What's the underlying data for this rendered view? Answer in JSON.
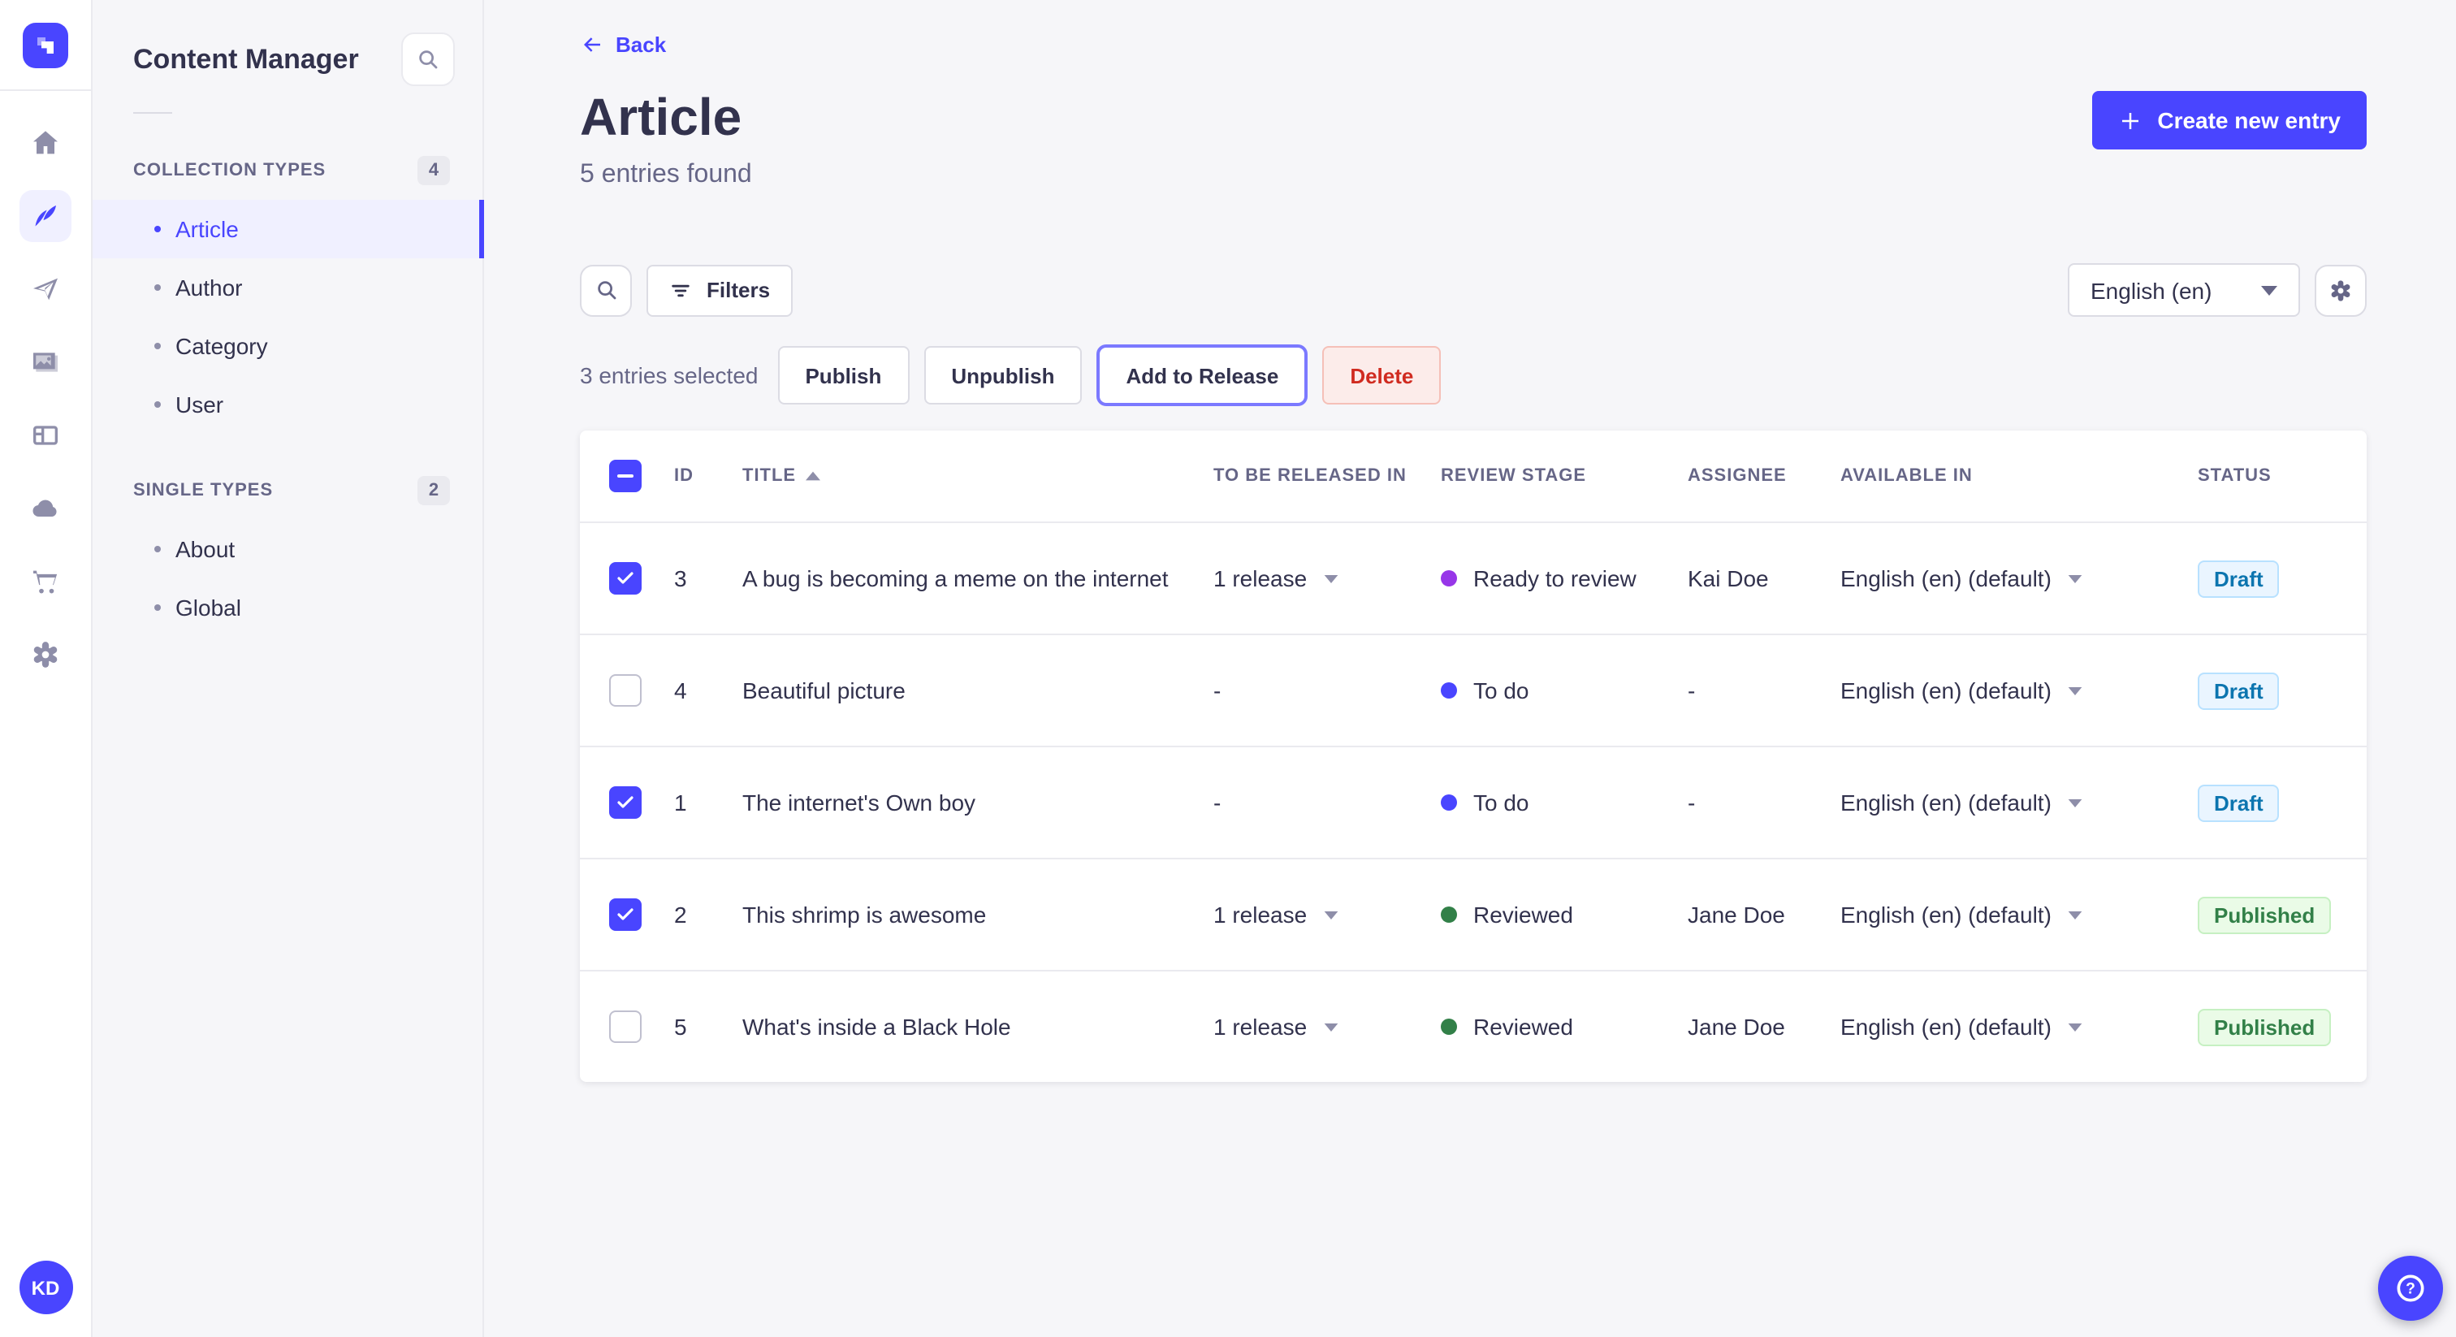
{
  "colors": {
    "primary": "#4945FF",
    "primary_light": "#F0F0FF",
    "text": "#32324D",
    "muted": "#666687",
    "border": "#EAEAEF",
    "status_draft_bg": "#EAF5FF",
    "status_draft_text": "#0C75AF",
    "status_published_bg": "#EAFBE7",
    "status_published_text": "#328048",
    "delete_bg": "#FCECEA",
    "delete_text": "#D02B20",
    "release_focus_border": "#7B79FF"
  },
  "rail": {
    "icons": [
      "strapi-logo",
      "home",
      "content-manager",
      "releases-paper-plane",
      "media-library",
      "content-type-builder",
      "cloud",
      "marketplace-cart",
      "settings-gear"
    ],
    "active_icon": "content-manager",
    "avatar_initials": "KD"
  },
  "subnav": {
    "title": "Content Manager",
    "sections": [
      {
        "label": "COLLECTION TYPES",
        "badge": "4",
        "items": [
          {
            "label": "Article",
            "active": true
          },
          {
            "label": "Author",
            "active": false
          },
          {
            "label": "Category",
            "active": false
          },
          {
            "label": "User",
            "active": false
          }
        ]
      },
      {
        "label": "SINGLE TYPES",
        "badge": "2",
        "items": [
          {
            "label": "About",
            "active": false
          },
          {
            "label": "Global",
            "active": false
          }
        ]
      }
    ]
  },
  "header": {
    "back_label": "Back",
    "title": "Article",
    "subtitle": "5 entries found",
    "create_button_label": "Create new entry"
  },
  "toolbar": {
    "filters_label": "Filters",
    "locale_select_value": "English (en)"
  },
  "selection_bar": {
    "selected_text": "3 entries selected",
    "publish_label": "Publish",
    "unpublish_label": "Unpublish",
    "add_to_release_label": "Add to Release",
    "delete_label": "Delete"
  },
  "table": {
    "headers": {
      "id": "ID",
      "title": "TITLE",
      "to_be_released_in": "TO BE RELEASED IN",
      "review_stage": "REVIEW STAGE",
      "assignee": "ASSIGNEE",
      "available_in": "AVAILABLE IN",
      "status": "STATUS"
    },
    "sort_column": "TITLE",
    "sort_direction": "asc",
    "rows": [
      {
        "selected": true,
        "id": "3",
        "title": "A bug is becoming a meme on the internet",
        "release": "1 release",
        "stage": "Ready to review",
        "stage_color": "#9736E8",
        "assignee": "Kai Doe",
        "available_in": "English (en) (default)",
        "status": "Draft"
      },
      {
        "selected": false,
        "id": "4",
        "title": "Beautiful picture",
        "release": "-",
        "stage": "To do",
        "stage_color": "#4945FF",
        "assignee": "-",
        "available_in": "English (en) (default)",
        "status": "Draft"
      },
      {
        "selected": true,
        "id": "1",
        "title": "The internet's Own boy",
        "release": "-",
        "stage": "To do",
        "stage_color": "#4945FF",
        "assignee": "-",
        "available_in": "English (en) (default)",
        "status": "Draft"
      },
      {
        "selected": true,
        "id": "2",
        "title": "This shrimp is awesome",
        "release": "1 release",
        "stage": "Reviewed",
        "stage_color": "#328048",
        "assignee": "Jane Doe",
        "available_in": "English (en) (default)",
        "status": "Published"
      },
      {
        "selected": false,
        "id": "5",
        "title": "What's inside a Black Hole",
        "release": "1 release",
        "stage": "Reviewed",
        "stage_color": "#328048",
        "assignee": "Jane Doe",
        "available_in": "English (en) (default)",
        "status": "Published"
      }
    ]
  }
}
